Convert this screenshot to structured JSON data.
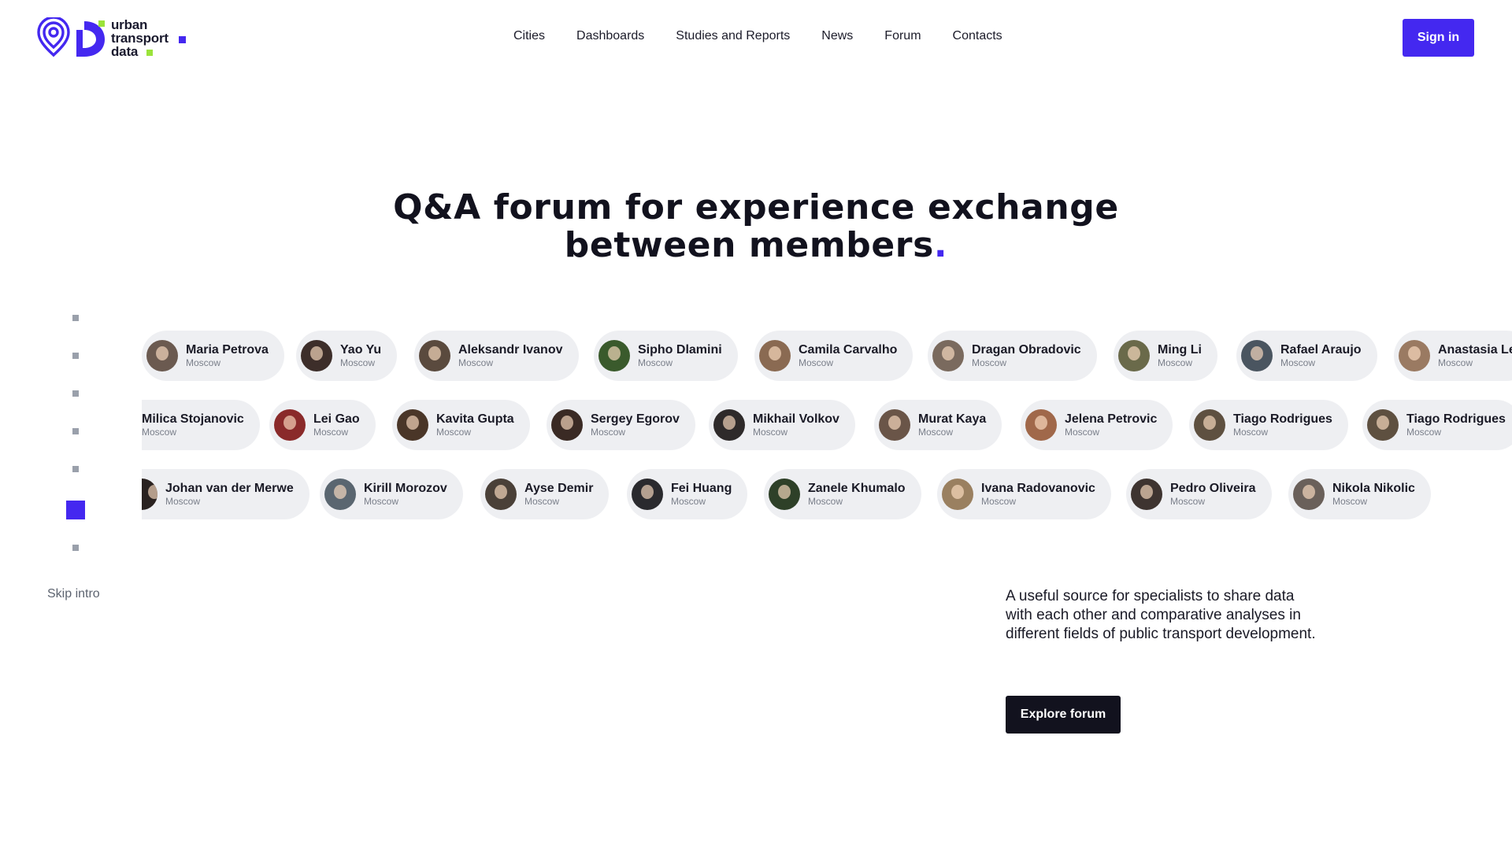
{
  "logo": {
    "line1": "urban",
    "line2": "transport",
    "line3": "data",
    "colors": {
      "primary": "#4428f0",
      "accent": "#9be33b"
    }
  },
  "nav": {
    "items": [
      "Cities",
      "Dashboards",
      "Studies and Reports",
      "News",
      "Forum",
      "Contacts"
    ]
  },
  "header": {
    "signin_label": "Sign in"
  },
  "hero": {
    "title_line1": "Q&A forum for experience exchange",
    "title_line2": "between members",
    "title_dot": "."
  },
  "intro": {
    "skip_label": "Skip intro",
    "steps_total": 7,
    "active_step": 6
  },
  "members": {
    "rows": [
      [
        {
          "name": "Maria Petrova",
          "city": "Moscow"
        },
        {
          "name": "Yao Yu",
          "city": "Moscow"
        },
        {
          "name": "Aleksandr Ivanov",
          "city": "Moscow"
        },
        {
          "name": "Sipho Dlamini",
          "city": "Moscow"
        },
        {
          "name": "Camila Carvalho",
          "city": "Moscow"
        },
        {
          "name": "Dragan Obradovic",
          "city": "Moscow"
        },
        {
          "name": "Ming Li",
          "city": "Moscow"
        },
        {
          "name": "Rafael Araujo",
          "city": "Moscow"
        },
        {
          "name": "Anastasia Le",
          "city": "Moscow"
        }
      ],
      [
        {
          "name": "Milica Stojanovic",
          "city": "Moscow"
        },
        {
          "name": "Lei Gao",
          "city": "Moscow"
        },
        {
          "name": "Kavita Gupta",
          "city": "Moscow"
        },
        {
          "name": "Sergey Egorov",
          "city": "Moscow"
        },
        {
          "name": "Mikhail Volkov",
          "city": "Moscow"
        },
        {
          "name": "Murat Kaya",
          "city": "Moscow"
        },
        {
          "name": "Jelena Petrovic",
          "city": "Moscow"
        },
        {
          "name": "Tiago Rodrigues",
          "city": "Moscow"
        },
        {
          "name": "Tiago Rodrigues",
          "city": "Moscow"
        }
      ],
      [
        {
          "name": "Johan van der Merwe",
          "city": "Moscow"
        },
        {
          "name": "Kirill Morozov",
          "city": "Moscow"
        },
        {
          "name": "Ayse Demir",
          "city": "Moscow"
        },
        {
          "name": "Fei Huang",
          "city": "Moscow"
        },
        {
          "name": "Zanele Khumalo",
          "city": "Moscow"
        },
        {
          "name": "Ivana Radovanovic",
          "city": "Moscow"
        },
        {
          "name": "Pedro Oliveira",
          "city": "Moscow"
        },
        {
          "name": "Nikola Nikolic",
          "city": "Moscow"
        }
      ]
    ]
  },
  "about": {
    "description": "A useful source for specialists to share data with each other and comparative analyses in different fields of public transport development.",
    "cta_label": "Explore forum"
  }
}
